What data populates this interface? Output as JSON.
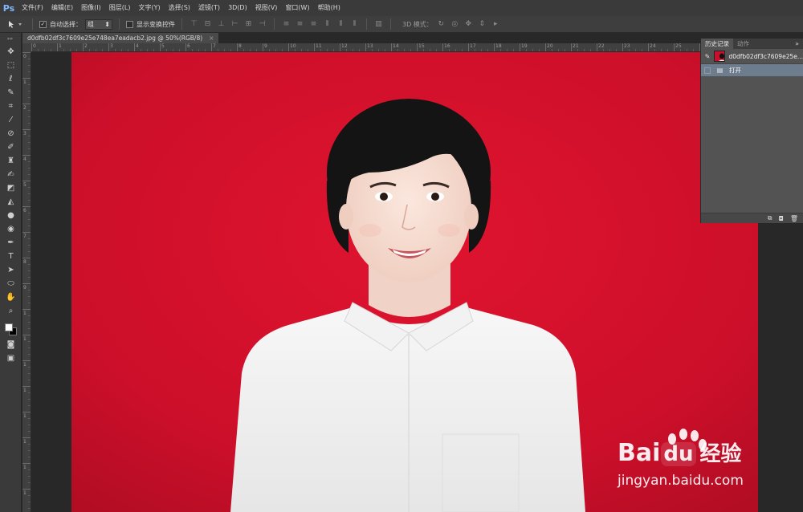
{
  "app": {
    "logo": "Ps"
  },
  "menu": [
    "文件(F)",
    "编辑(E)",
    "图像(I)",
    "图层(L)",
    "文字(Y)",
    "选择(S)",
    "滤镜(T)",
    "3D(D)",
    "视图(V)",
    "窗口(W)",
    "帮助(H)"
  ],
  "options": {
    "auto_select_label": "自动选择：",
    "auto_select_value": "组",
    "show_transform_label": "显示变换控件",
    "mode3d_label": "3D 模式："
  },
  "document": {
    "tab_title": "d0dfb02df3c7609e25e748ea7eadacb2.jpg @ 50%(RGB/8)",
    "close_glyph": "×"
  },
  "rulers": {
    "top": [
      "0",
      "1",
      "2",
      "3",
      "4",
      "5",
      "6",
      "7",
      "8",
      "9",
      "10",
      "11",
      "12",
      "13",
      "14",
      "15",
      "16",
      "17",
      "18",
      "19",
      "20",
      "21",
      "22",
      "23",
      "24",
      "25",
      "26"
    ],
    "left": [
      "0",
      "1",
      "2",
      "3",
      "4",
      "5",
      "6",
      "7",
      "8",
      "9",
      "1",
      "1",
      "1",
      "1",
      "1",
      "1",
      "1",
      "1",
      "1"
    ]
  },
  "history_panel": {
    "tabs": [
      "历史记录",
      "动作"
    ],
    "menu_glyph": "»",
    "snapshot_name": "d0dfb02df3c7609e25e...",
    "state_label": "打开"
  },
  "watermark": {
    "brand_a": "Bai",
    "brand_b": "du",
    "brand_cn": "经验",
    "url": "jingyan.baidu.com"
  },
  "colors": {
    "background_red": "#c8102e",
    "foreground_swatch": "#ffffff",
    "background_swatch": "#000000",
    "history_selected": "#6e7d8e"
  },
  "icons": {
    "toolbar": [
      "move-icon",
      "marquee-icon",
      "lasso-icon",
      "quick-select-icon",
      "crop-icon",
      "eyedropper-icon",
      "healing-brush-icon",
      "brush-icon",
      "clone-stamp-icon",
      "history-brush-icon",
      "eraser-icon",
      "paint-bucket-icon",
      "blur-icon",
      "dodge-icon",
      "pen-icon",
      "type-icon",
      "path-select-icon",
      "ellipse-icon",
      "hand-icon",
      "zoom-icon"
    ]
  }
}
